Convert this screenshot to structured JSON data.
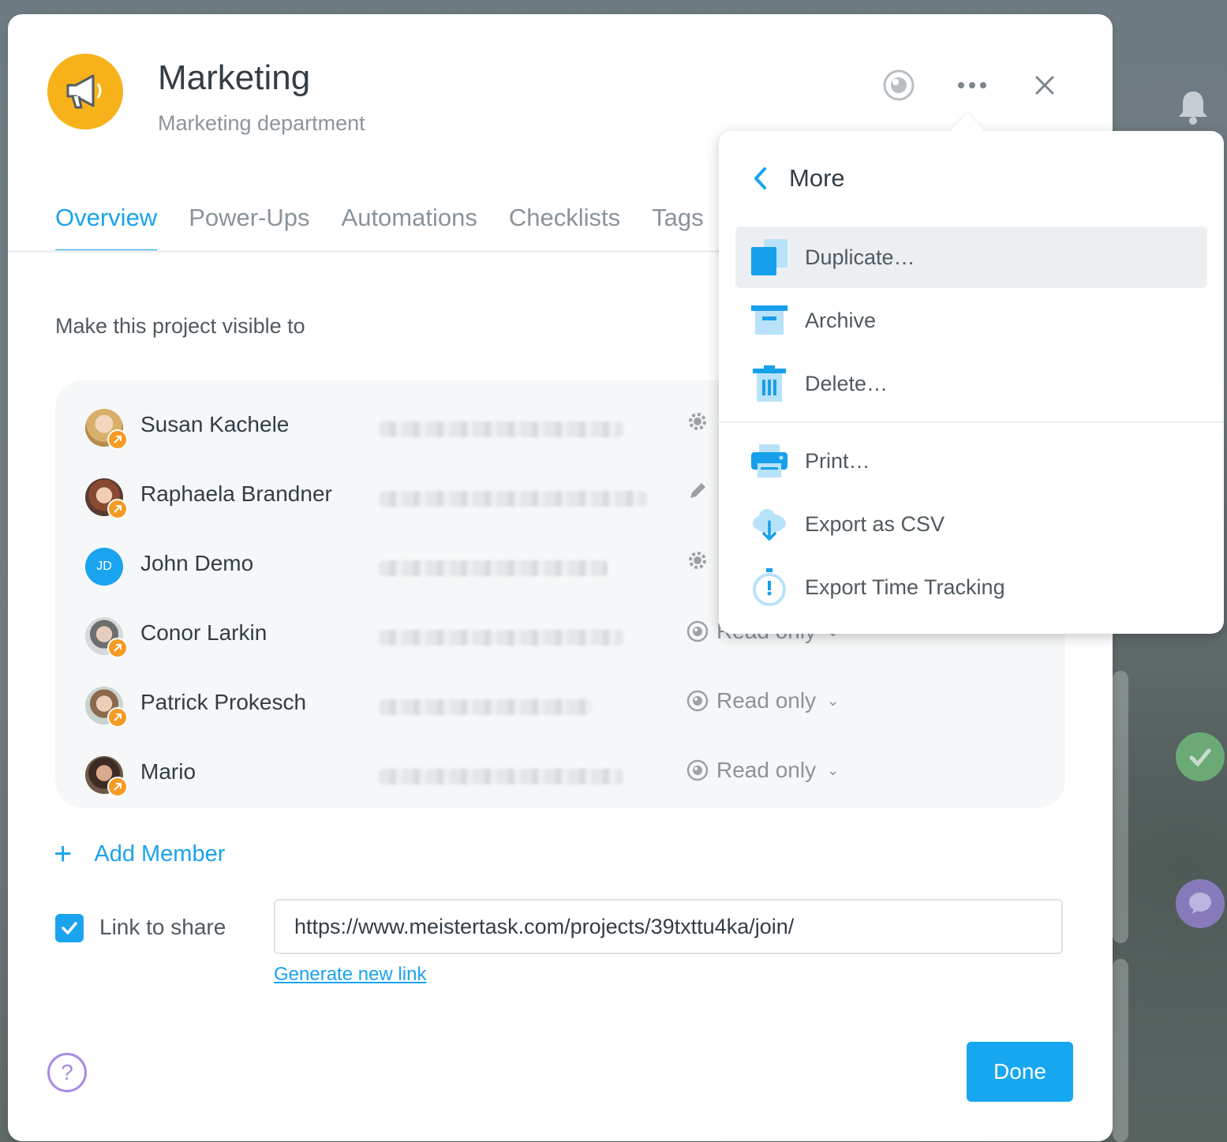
{
  "project": {
    "title": "Marketing",
    "subtitle": "Marketing department",
    "icon": "megaphone-icon",
    "icon_color": "#f7b21a"
  },
  "header_actions": [
    "watch-icon",
    "more-icon",
    "close-icon"
  ],
  "tabs": [
    {
      "label": "Overview",
      "active": true
    },
    {
      "label": "Power-Ups",
      "active": false
    },
    {
      "label": "Automations",
      "active": false
    },
    {
      "label": "Checklists",
      "active": false
    },
    {
      "label": "Tags",
      "active": false
    }
  ],
  "visibility_label": "Make this project visible to",
  "members": [
    {
      "name": "Susan Kachele",
      "role_icon": "gear-icon",
      "role": ""
    },
    {
      "name": "Raphaela Brandner",
      "role_icon": "pencil-icon",
      "role": ""
    },
    {
      "name": "John Demo",
      "initials": "JD",
      "role_icon": "gear-icon",
      "role": ""
    },
    {
      "name": "Conor Larkin",
      "role_icon": "eye-icon",
      "role": "Read only"
    },
    {
      "name": "Patrick Prokesch",
      "role_icon": "eye-icon",
      "role": "Read only"
    },
    {
      "name": "Mario",
      "role_icon": "eye-icon",
      "role": "Read only"
    }
  ],
  "add_member_label": "Add Member",
  "share": {
    "checkbox_checked": true,
    "label": "Link to share",
    "url": "https://www.meistertask.com/projects/39txttu4ka/join/",
    "generate_label": "Generate new link"
  },
  "done_label": "Done",
  "more_menu": {
    "title": "More",
    "items": [
      {
        "label": "Duplicate…",
        "icon": "duplicate-icon",
        "highlighted": true
      },
      {
        "label": "Archive",
        "icon": "archive-icon"
      },
      {
        "label": "Delete…",
        "icon": "trash-icon"
      },
      {
        "label": "Print…",
        "icon": "printer-icon"
      },
      {
        "label": "Export as CSV",
        "icon": "cloud-download-icon"
      },
      {
        "label": "Export Time Tracking",
        "icon": "stopwatch-icon"
      }
    ]
  },
  "colors": {
    "accent": "#1aa3ee",
    "help": "#a88ae6",
    "badge": "#f59a23"
  }
}
